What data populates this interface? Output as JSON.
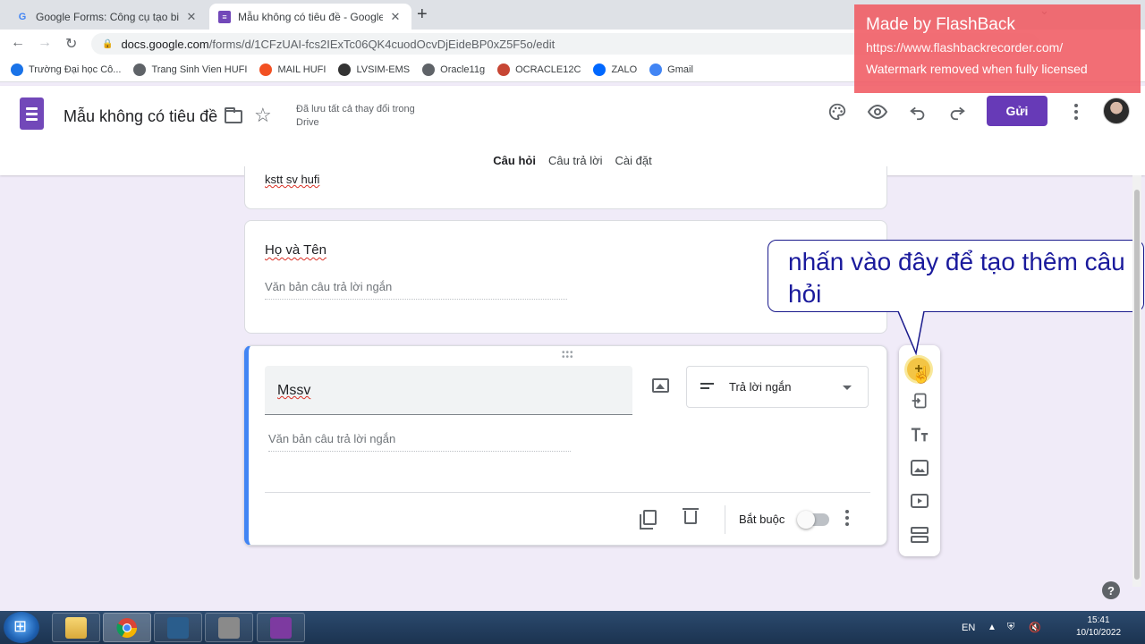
{
  "browser": {
    "tabs": [
      {
        "title": "Google Forms: Công cụ tạo biểu",
        "active": false
      },
      {
        "title": "Mẫu không có tiêu đề - Google F",
        "active": true
      }
    ],
    "url_host": "docs.google.com",
    "url_path": "/forms/d/1CFzUAI-fcs2IExTc06QK4cuodOcvDjEideBP0xZ5F5o/edit",
    "bookmarks": [
      {
        "label": "Trường Đại học Cô...",
        "icon": "school-icon",
        "color": "#1a73e8"
      },
      {
        "label": "Trang Sinh Vien HUFI",
        "icon": "globe-icon",
        "color": "#5f6368"
      },
      {
        "label": "MAIL HUFI",
        "icon": "microsoft-icon",
        "color": "#f25022"
      },
      {
        "label": "LVSIM-EMS",
        "icon": "lvsim-icon",
        "color": "#333333"
      },
      {
        "label": "Oracle11g",
        "icon": "globe-icon",
        "color": "#5f6368"
      },
      {
        "label": "OCRACLE12C",
        "icon": "oracle-icon",
        "color": "#c74634"
      },
      {
        "label": "ZALO",
        "icon": "zalo-icon",
        "color": "#0068ff"
      },
      {
        "label": "Gmail",
        "icon": "google-icon",
        "color": "#4285f4"
      }
    ]
  },
  "watermark": {
    "title": "Made by FlashBack",
    "url": "https://www.flashbackrecorder.com/",
    "note": "Watermark removed when fully licensed"
  },
  "header": {
    "form_title": "Mẫu không có tiêu đề",
    "save_status": "Đã lưu tất cả thay đổi trong Drive",
    "send_label": "Gửi",
    "tabs": [
      "Câu hỏi",
      "Câu trả lời",
      "Cài đặt"
    ],
    "accent": "#673ab7"
  },
  "form": {
    "top_card_text": "kstt sv hufi",
    "questions": [
      {
        "title": "Họ và Tên",
        "answer_placeholder": "Văn bản câu trả lời ngắn"
      },
      {
        "title": "Mssv",
        "answer_placeholder": "Văn bản câu trả lời ngắn",
        "type": "Trả lời ngắn",
        "required_label": "Bắt buộc",
        "required": false
      }
    ]
  },
  "callout": {
    "text": "nhấn vào đây để tạo thêm câu hỏi"
  },
  "taskbar": {
    "language": "EN",
    "time": "15:41",
    "date": "10/10/2022"
  }
}
